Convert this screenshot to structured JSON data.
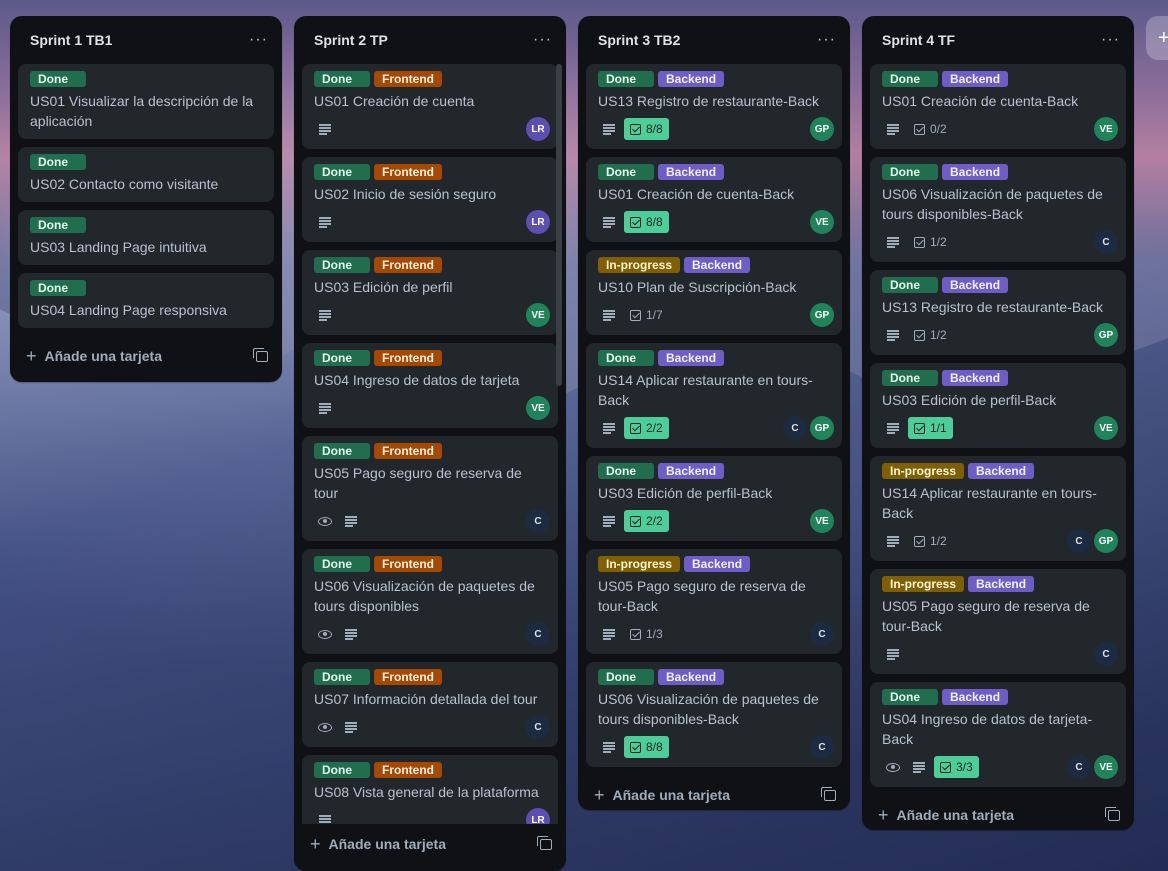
{
  "board": {
    "add_list_symbol": "+",
    "lists": [
      {
        "title": "Sprint 1 TB1",
        "menu": "···",
        "add_label": "Añade una tarjeta",
        "cards": [
          {
            "labels": [
              "Done"
            ],
            "title": "US01 Visualizar la descripción de la aplicación"
          },
          {
            "labels": [
              "Done"
            ],
            "title": "US02 Contacto como visitante"
          },
          {
            "labels": [
              "Done"
            ],
            "title": "US03 Landing Page intuitiva"
          },
          {
            "labels": [
              "Done"
            ],
            "title": "US04 Landing Page responsiva"
          }
        ]
      },
      {
        "title": "Sprint 2 TP",
        "menu": "···",
        "add_label": "Añade una tarjeta",
        "cards": [
          {
            "labels": [
              "Done",
              "Frontend"
            ],
            "title": "US01 Creación de cuenta",
            "members": [
              "LR"
            ]
          },
          {
            "labels": [
              "Done",
              "Frontend"
            ],
            "title": "US02 Inicio de sesión seguro",
            "members": [
              "LR"
            ]
          },
          {
            "labels": [
              "Done",
              "Frontend"
            ],
            "title": "US03 Edición de perfil",
            "members": [
              "VE"
            ]
          },
          {
            "labels": [
              "Done",
              "Frontend"
            ],
            "title": "US04 Ingreso de datos de tarjeta",
            "members": [
              "VE"
            ]
          },
          {
            "labels": [
              "Done",
              "Frontend"
            ],
            "title": "US05 Pago seguro de reserva de tour",
            "watch": true,
            "members": [
              "C"
            ]
          },
          {
            "labels": [
              "Done",
              "Frontend"
            ],
            "title": "US06 Visualización de paquetes de tours disponibles",
            "watch": true,
            "members": [
              "C"
            ]
          },
          {
            "labels": [
              "Done",
              "Frontend"
            ],
            "title": "US07 Información detallada del tour",
            "watch": true,
            "members": [
              "C"
            ]
          },
          {
            "labels": [
              "Done",
              "Frontend"
            ],
            "title": "US08 Vista general de la plataforma",
            "members": [
              "LR"
            ]
          }
        ]
      },
      {
        "title": "Sprint 3 TB2",
        "menu": "···",
        "add_label": "Añade una tarjeta",
        "cards": [
          {
            "labels": [
              "Done",
              "Backend"
            ],
            "title": "US13 Registro de restaurante-Back",
            "checklist": "8/8",
            "complete": true,
            "members": [
              "GP"
            ]
          },
          {
            "labels": [
              "Done",
              "Backend"
            ],
            "title": "US01 Creación de cuenta-Back",
            "checklist": "8/8",
            "complete": true,
            "members": [
              "VE"
            ]
          },
          {
            "labels": [
              "In-progress",
              "Backend"
            ],
            "title": "US10 Plan de Suscripción-Back",
            "checklist": "1/7",
            "complete": false,
            "members": [
              "GP"
            ]
          },
          {
            "labels": [
              "Done",
              "Backend"
            ],
            "title": "US14 Aplicar restaurante en tours-Back",
            "checklist": "2/2",
            "complete": true,
            "members": [
              "C",
              "GP"
            ]
          },
          {
            "labels": [
              "Done",
              "Backend"
            ],
            "title": "US03 Edición de perfil-Back",
            "checklist": "2/2",
            "complete": true,
            "members": [
              "VE"
            ]
          },
          {
            "labels": [
              "In-progress",
              "Backend"
            ],
            "title": "US05 Pago seguro de reserva de tour-Back",
            "checklist": "1/3",
            "complete": false,
            "members": [
              "C"
            ]
          },
          {
            "labels": [
              "Done",
              "Backend"
            ],
            "title": "US06 Visualización de paquetes de tours disponibles-Back",
            "checklist": "8/8",
            "complete": true,
            "members": [
              "C"
            ]
          }
        ]
      },
      {
        "title": "Sprint 4 TF",
        "menu": "···",
        "add_label": "Añade una tarjeta",
        "cards": [
          {
            "labels": [
              "Done",
              "Backend"
            ],
            "title": "US01 Creación de cuenta-Back",
            "checklist": "0/2",
            "complete": false,
            "members": [
              "VE"
            ]
          },
          {
            "labels": [
              "Done",
              "Backend"
            ],
            "title": "US06 Visualización de paquetes de tours disponibles-Back",
            "checklist": "1/2",
            "complete": false,
            "members": [
              "C"
            ]
          },
          {
            "labels": [
              "Done",
              "Backend"
            ],
            "title": "US13 Registro de restaurante-Back",
            "checklist": "1/2",
            "complete": false,
            "members": [
              "GP"
            ]
          },
          {
            "labels": [
              "Done",
              "Backend"
            ],
            "title": "US03 Edición de perfil-Back",
            "checklist": "1/1",
            "complete": true,
            "members": [
              "VE"
            ]
          },
          {
            "labels": [
              "In-progress",
              "Backend"
            ],
            "title": "US14 Aplicar restaurante en tours-Back",
            "checklist": "1/2",
            "complete": false,
            "members": [
              "C",
              "GP"
            ]
          },
          {
            "labels": [
              "In-progress",
              "Backend"
            ],
            "title": "US05 Pago seguro de reserva de tour-Back",
            "members": [
              "C"
            ]
          },
          {
            "labels": [
              "Done",
              "Backend"
            ],
            "title": "US04 Ingreso de datos de tarjeta-Back",
            "watch": true,
            "checklist": "3/3",
            "complete": true,
            "members": [
              "C",
              "VE"
            ]
          }
        ]
      }
    ]
  },
  "colors": {
    "done": "#216e4e",
    "frontend": "#a54800",
    "backend": "#6e5dc6",
    "in_progress": "#7f5f01",
    "list_bg": "#0f1114",
    "card_bg": "#22272b",
    "checklist_complete": "#4bce97"
  }
}
